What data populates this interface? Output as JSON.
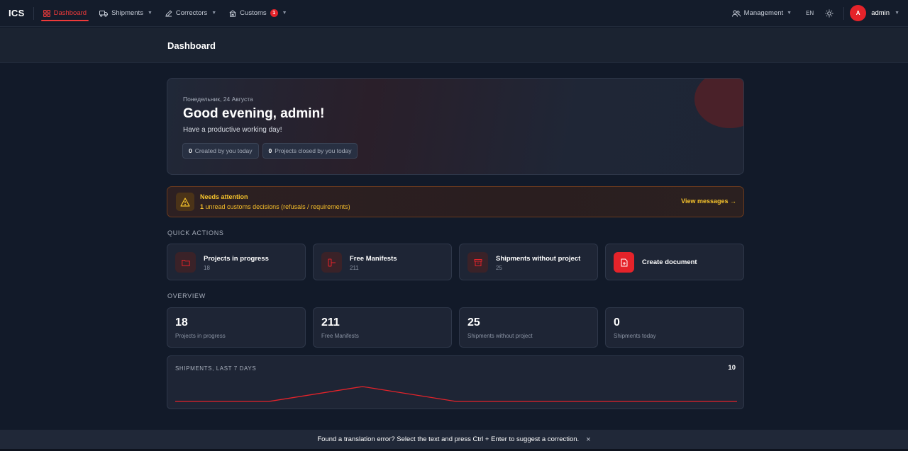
{
  "nav": {
    "logo": "ICS",
    "items": [
      {
        "label": "Dashboard",
        "icon": "grid-icon"
      },
      {
        "label": "Shipments",
        "icon": "truck-icon"
      },
      {
        "label": "Correctors",
        "icon": "pencil-icon"
      },
      {
        "label": "Customs",
        "icon": "building-icon",
        "badge": "1"
      }
    ],
    "management": "Management",
    "lang": "EN",
    "avatar_letter": "A",
    "user": "admin"
  },
  "page": {
    "title": "Dashboard"
  },
  "greeting": {
    "date": "Понедельник, 24 Августа",
    "title": "Good evening, admin!",
    "subtitle": "Have a productive working day!",
    "chips": [
      {
        "value": "0",
        "label": "Created by you today"
      },
      {
        "value": "0",
        "label": "Projects closed by you today"
      }
    ]
  },
  "attention": {
    "title": "Needs attention",
    "count": "1",
    "text": "unread customs decisions (refusals / requirements)",
    "link": "View messages →"
  },
  "quick_actions": {
    "label": "QUICK ACTIONS",
    "items": [
      {
        "title": "Projects in progress",
        "count": "18",
        "icon": "folder-icon"
      },
      {
        "title": "Free Manifests",
        "count": "211",
        "icon": "manifest-icon"
      },
      {
        "title": "Shipments without project",
        "count": "25",
        "icon": "archive-icon"
      },
      {
        "title": "Create document",
        "icon": "file-plus-icon"
      }
    ]
  },
  "overview": {
    "label": "OVERVIEW",
    "items": [
      {
        "value": "18",
        "label": "Projects in progress"
      },
      {
        "value": "211",
        "label": "Free Manifests"
      },
      {
        "value": "25",
        "label": "Shipments without project"
      },
      {
        "value": "0",
        "label": "Shipments today"
      }
    ]
  },
  "chart": {
    "title": "SHIPMENTS, LAST 7 DAYS",
    "max_label": "10",
    "color": "#e5232a"
  },
  "chart_data": {
    "type": "line",
    "title": "SHIPMENTS, LAST 7 DAYS",
    "x": [
      1,
      2,
      3,
      4,
      5,
      6,
      7
    ],
    "series": [
      {
        "values": [
          0,
          0,
          5,
          0,
          0,
          0,
          0
        ]
      }
    ],
    "ylim": [
      0,
      10
    ],
    "grid": false
  },
  "footer": {
    "text": "Found a translation error? Select the text and press Ctrl + Enter to suggest a correction.",
    "close": "×"
  },
  "colors": {
    "accent": "#e5232a",
    "warning": "#f6c32c",
    "background": "#121a29",
    "card": "#1e2535"
  }
}
